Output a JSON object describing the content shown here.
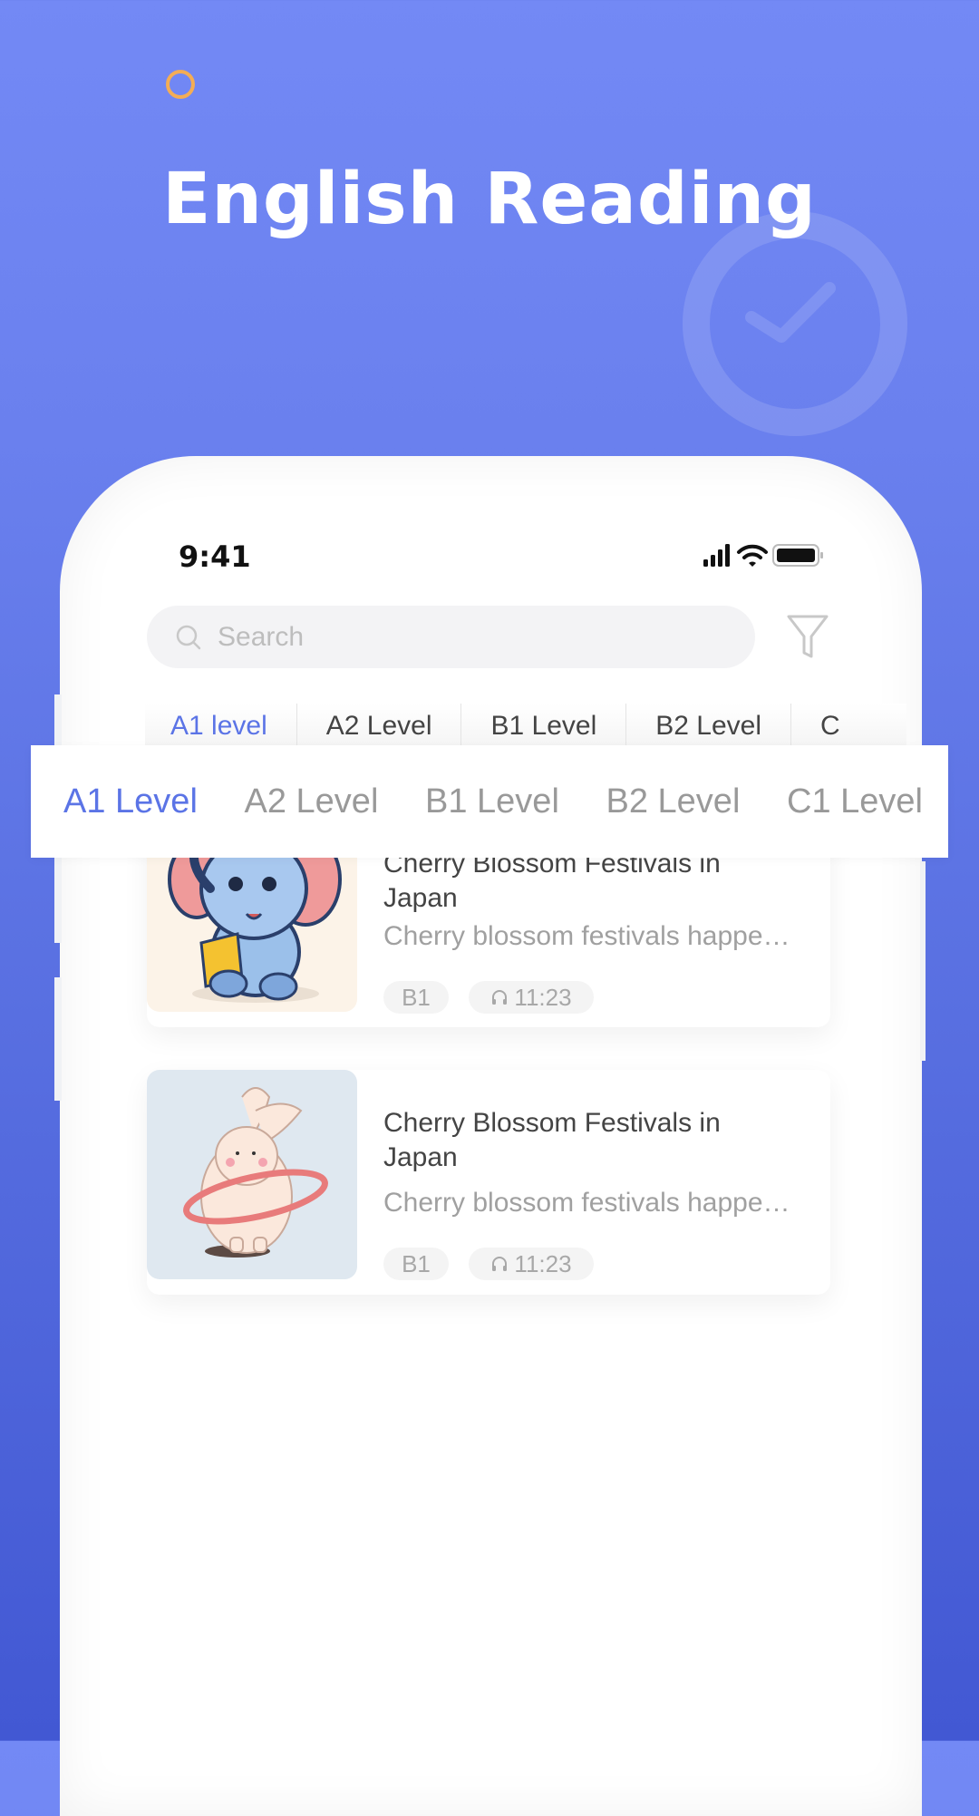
{
  "hero": {
    "title": "English Reading",
    "colors": {
      "background_top": "#7389f5",
      "background_bottom": "#4258d3",
      "accent_ring": "#f4ad55"
    }
  },
  "status_bar": {
    "time": "9:41"
  },
  "search": {
    "placeholder": "Search",
    "value": ""
  },
  "inner_tabs": [
    {
      "label": "A1 level",
      "active": true
    },
    {
      "label": "A2 Level",
      "active": false
    },
    {
      "label": "B1 Level",
      "active": false
    },
    {
      "label": "B2 Level",
      "active": false
    },
    {
      "label": "C",
      "active": false
    }
  ],
  "overlay_tabs": [
    {
      "label": "A1 Level",
      "active": true
    },
    {
      "label": "A2 Level",
      "active": false
    },
    {
      "label": "B1 Level",
      "active": false
    },
    {
      "label": "B2 Level",
      "active": false
    },
    {
      "label": "C1 Level",
      "active": false
    }
  ],
  "articles": [
    {
      "title": "Cherry Blossom Festivals in Japan",
      "description": "Cherry blossom festivals happe…",
      "level": "B1",
      "duration": "11:23",
      "image": "elephant-reading-illustration"
    },
    {
      "title": "Cherry Blossom Festivals in Japan",
      "description": "Cherry blossom festivals happe…",
      "level": "B1",
      "duration": "11:23",
      "image": "rabbit-hula-hoop-illustration"
    }
  ],
  "accent_color": "#5b74e6"
}
